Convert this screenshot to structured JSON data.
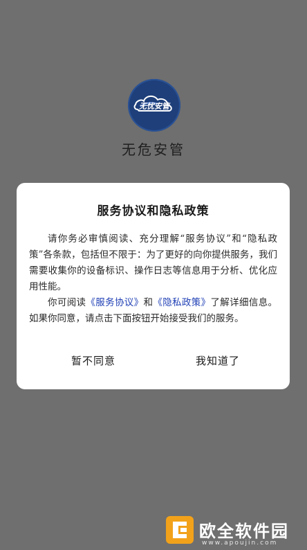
{
  "app": {
    "logo_text": "无忧安管",
    "name": "无危安管"
  },
  "dialog": {
    "title": "服务协议和隐私政策",
    "para1": "请你务必审慎阅读、充分理解“服务协议”和“隐私政策”各条款，包括但不限于：为了更好的向你提供服务，我们需要收集你的设备标识、操作日志等信息用于分析、优化应用性能。",
    "para2_prefix": "你可阅读",
    "link_service": "《服务协议》",
    "para2_and": "和",
    "link_privacy": "《隐私政策》",
    "para2_suffix": "了解详细信息。如果你同意，请点击下面按钮开始接受我们的服务。",
    "decline_label": "暂不同意",
    "accept_label": "我知道了"
  },
  "watermark": {
    "brand": "欧全软件园",
    "url": "www.apoujin.com"
  },
  "colors": {
    "overlay": "#6f6f6f",
    "logo_bg": "#1e3f7a",
    "link": "#1f3fb5",
    "watermark_icon": "#f2a21a"
  },
  "icons": {
    "logo": "cloud-logo-icon",
    "watermark": "brand-icon"
  }
}
